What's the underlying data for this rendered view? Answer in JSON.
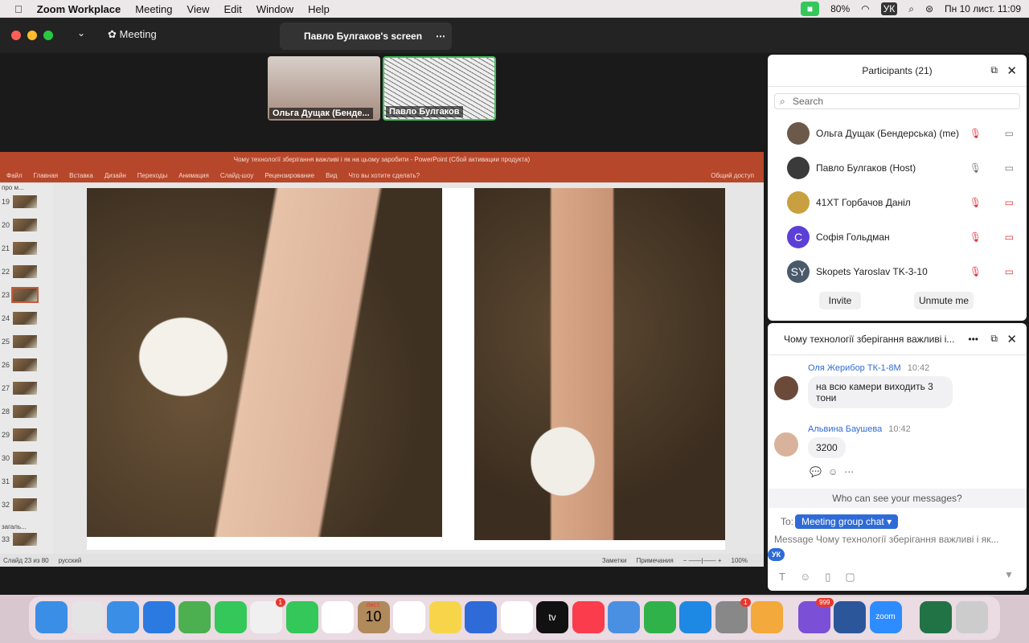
{
  "menubar": {
    "app": "Zoom Workplace",
    "items": [
      "Meeting",
      "View",
      "Edit",
      "Window",
      "Help"
    ],
    "battery": "80%",
    "keyboard": "УК",
    "datetime": "Пн 10 лист.  11:09"
  },
  "zoom": {
    "title": "Meeting",
    "share_tab": "Павло Булгаков's screen",
    "thumbnails": [
      {
        "name": "Ольга Дущак (Бенде..."
      },
      {
        "name": "Павло Булгаков"
      }
    ]
  },
  "ppt": {
    "title": "Чому технології зберігання важливі і як на цьому заробити - PowerPoint (Сбой активации продукта)",
    "ribbon": [
      "Файл",
      "Главная",
      "Вставка",
      "Дизайн",
      "Переходы",
      "Анимация",
      "Слайд-шоу",
      "Рецензирование",
      "Вид"
    ],
    "tell_me": "Что вы хотите сделать?",
    "share": "Общий доступ",
    "section1": "про м...",
    "section2": "загаль...",
    "slides": [
      "19",
      "20",
      "21",
      "22",
      "23",
      "24",
      "25",
      "26",
      "27",
      "28",
      "29",
      "30",
      "31",
      "32",
      "33"
    ],
    "selected_slide": "23",
    "status_slide": "Слайд 23 из 80",
    "language": "русский",
    "notes": "Заметки",
    "comments": "Примечания",
    "zoom": "100%"
  },
  "participants": {
    "title": "Participants (21)",
    "search_placeholder": "Search",
    "list": [
      {
        "name": "Ольга Дущак (Бендерська) (me)",
        "initials": "",
        "color": "#6b5a4a"
      },
      {
        "name": "Павло Булгаков (Host)",
        "initials": "",
        "color": "#3a3a3a"
      },
      {
        "name": "41ХТ Горбачов Даніл",
        "initials": "",
        "color": "#c9a040"
      },
      {
        "name": "Софія Гольдман",
        "initials": "C",
        "color": "#5b3fd6"
      },
      {
        "name": "Skopets Yaroslav TK-3-10",
        "initials": "SY",
        "color": "#4a5a6a"
      }
    ],
    "invite": "Invite",
    "unmute": "Unmute me"
  },
  "chat": {
    "title": "Чому технології зберігання важливі і...",
    "messages": [
      {
        "sender": "Оля Жерибор ТК-1-8М",
        "time": "10:42",
        "text": "на всю камери виходить  3 тони"
      },
      {
        "sender": "Альвина Баушева",
        "time": "10:42",
        "text": "3200"
      }
    ],
    "who_can_see": "Who can see your messages?",
    "to_label": "To:",
    "recipient": "Meeting group chat ▾",
    "placeholder": "Message Чому технології зберігання важливі і як...",
    "input_lang": "УК"
  },
  "dock": {
    "calendar_month": "лист.",
    "calendar_day": "10",
    "messages_badge": "1",
    "settings_badge": "1",
    "viber_badge": "999",
    "zoom_label": "zoom",
    "tv_label": "tv"
  }
}
